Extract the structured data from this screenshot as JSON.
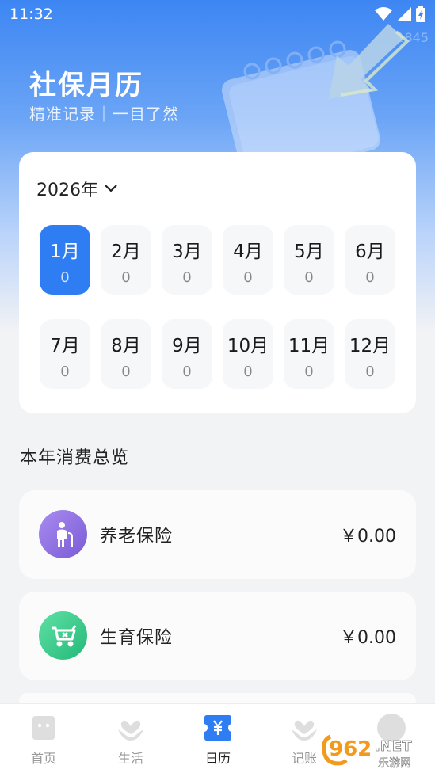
{
  "status": {
    "time": "11:32",
    "watermark": "1845"
  },
  "hero": {
    "title": "社保月历",
    "subtitle": "精准记录｜一目了然"
  },
  "calendar": {
    "year_label": "2026年",
    "months": [
      {
        "label": "1月",
        "count": "0",
        "active": true
      },
      {
        "label": "2月",
        "count": "0"
      },
      {
        "label": "3月",
        "count": "0"
      },
      {
        "label": "4月",
        "count": "0"
      },
      {
        "label": "5月",
        "count": "0"
      },
      {
        "label": "6月",
        "count": "0"
      },
      {
        "label": "7月",
        "count": "0"
      },
      {
        "label": "8月",
        "count": "0"
      },
      {
        "label": "9月",
        "count": "0"
      },
      {
        "label": "10月",
        "count": "0"
      },
      {
        "label": "11月",
        "count": "0"
      },
      {
        "label": "12月",
        "count": "0"
      }
    ]
  },
  "summary": {
    "title": "本年消费总览",
    "items": [
      {
        "name": "养老保险",
        "amount": "￥0.00",
        "icon": "elderly-person-icon",
        "color": "#8f6ee0"
      },
      {
        "name": "生育保险",
        "amount": "￥0.00",
        "icon": "baby-stroller-icon",
        "color": "#35cc8c"
      }
    ]
  },
  "tabs": [
    {
      "label": "首页",
      "icon": "home-icon"
    },
    {
      "label": "生活",
      "icon": "heart-hand-icon"
    },
    {
      "label": "日历",
      "icon": "yen-ticket-icon",
      "active": true
    },
    {
      "label": "记账",
      "icon": "heart-hand-icon"
    },
    {
      "label": "",
      "icon": "profile-icon"
    }
  ],
  "watermark_logo": {
    "text": "962",
    "suffix": ".NET",
    "sub": "乐游网"
  },
  "colors": {
    "accent": "#2f7df2",
    "background": "#f2f3f5"
  }
}
